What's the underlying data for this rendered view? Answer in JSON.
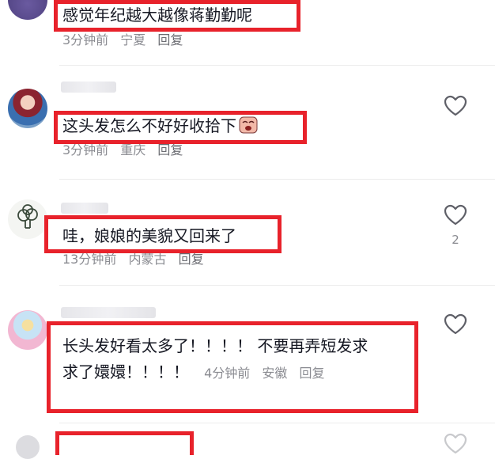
{
  "comments": [
    {
      "text": "感觉年纪越大越像蒋勤勤呢",
      "time": "3分钟前",
      "location": "宁夏",
      "reply": "回复",
      "likes": ""
    },
    {
      "text": "这头发怎么不好好收拾下",
      "time": "3分钟前",
      "location": "重庆",
      "reply": "回复",
      "likes": ""
    },
    {
      "text": "哇，娘娘的美貌又回来了",
      "time": "13分钟前",
      "location": "内蒙古",
      "reply": "回复",
      "likes": "2"
    },
    {
      "text_line1": "长头发好看太多了！！！！ 不要再弄短发求",
      "text_line2": "求了嬛嬛！！！！",
      "time": "4分钟前",
      "location": "安徽",
      "reply": "回复",
      "likes": ""
    }
  ],
  "colors": {
    "highlight": "#e8222b",
    "meta_text": "#8a8b91",
    "heart_stroke": "#5f6068"
  }
}
